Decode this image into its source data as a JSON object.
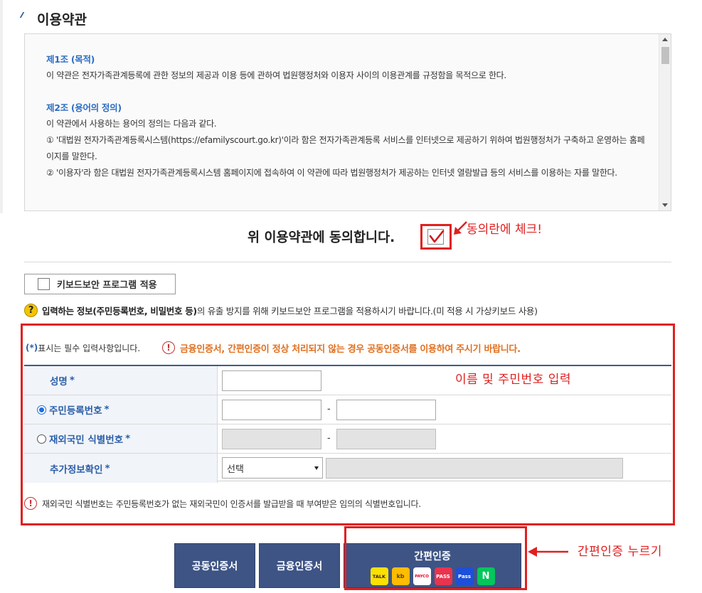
{
  "section": {
    "title": "이용약관"
  },
  "terms": {
    "art1_title": "제1조 (목적)",
    "art1_body": "이 약관은 전자가족관계등록에 관한 정보의 제공과 이용 등에 관하여 법원행정처와 이용자 사이의 이용관계를 규정함을 목적으로 한다.",
    "art2_title": "제2조 (용어의 정의)",
    "art2_intro": "이 약관에서 사용하는 용어의 정의는 다음과 같다.",
    "art2_item1": "① '대법원 전자가족관계등록시스템(https://efamilyscourt.go.kr)'이라 함은 전자가족관계등록 서비스를 인터넷으로 제공하기 위하여 법원행정처가 구축하고 운영하는 홈페이지를 말한다.",
    "art2_item2": "② '이용자'라 함은 대법원 전자가족관계등록시스템 홈페이지에 접속하여 이 약관에 따라 법원행정처가 제공하는 인터넷 열람발급 등의 서비스를 이용하는 자를 말한다."
  },
  "agree": {
    "label": "위 이용약관에 동의합니다.",
    "checked": true
  },
  "annotations": {
    "agree_callout": "동의란에 체크!",
    "input_callout": "이름 및 주민번호 입력",
    "simple_callout": "간편인증 누르기",
    "color": "#e02020"
  },
  "keyboard": {
    "button_label": "키보드보안 프로그램 적용",
    "note_bold": "입력하는 정보(주민등록번호, 비밀번호 등)",
    "note_rest": "의 유출 방지를 위해 키보드보안 프로그램을 적용하시기 바랍니다.(미 적용 시 가상키보드 사용)"
  },
  "form": {
    "required_mark": "(*)",
    "required_note": " 표시는 필수 입력사항입니다.",
    "warning": "금융인증서, 간편인증이 정상 처리되지 않는 경우 공동인증서를 이용하여 주시기 바랍니다.",
    "rows": {
      "name": {
        "label": "성명",
        "value": ""
      },
      "rrn": {
        "label": "주민등록번호",
        "selected": true,
        "front": "",
        "back": ""
      },
      "foreign": {
        "label": "재외국민 식별번호",
        "selected": false
      },
      "extra": {
        "label": "추가정보확인",
        "select_value": "선택"
      }
    },
    "star": "*",
    "dash": "-",
    "foreign_note": "재외국민 식별번호는 주민등록번호가 없는 재외국민이 인증서를 발급받을 때 부여받은 임의의 식별번호입니다."
  },
  "buttons": {
    "public_cert": "공동인증서",
    "financial_cert": "금융인증서",
    "simple_auth": "간편인증",
    "providers": [
      "TALK",
      "kb",
      "PAYCO",
      "PASS",
      "Pass",
      "N"
    ]
  },
  "colors": {
    "accent": "#2d5fa8",
    "button": "#3e5485",
    "warning": "#e07020"
  }
}
